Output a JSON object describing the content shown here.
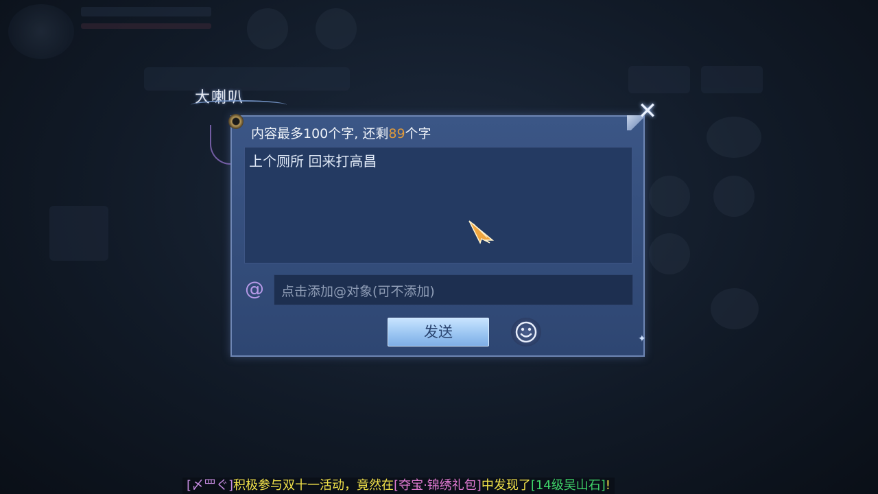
{
  "title": "大喇叭",
  "hint": {
    "prefix": "内容最多100个字, 还剩",
    "remaining": "89",
    "suffix": "个字"
  },
  "message_text": "上个厕所 回来打高昌",
  "mention_placeholder": "点击添加@对象(可不添加)",
  "send_label": "发送",
  "at_symbol": "@",
  "close_symbol": "✕",
  "announcement": {
    "name": "[〆罒ぐ]",
    "text1": "积极参与双十一活动，竟然在",
    "item1": "[夺宝·锦绣礼包]",
    "text2": "中发现了",
    "item2": "[14级吴山石]",
    "end": "!"
  },
  "colors": {
    "accent_orange": "#e09a3a",
    "name_purple": "#c58be0",
    "text_yellow": "#f2e24a",
    "item_pink": "#e07ad2",
    "item_green": "#3fd56a"
  },
  "icons": [
    "close-icon",
    "at-icon",
    "emoji-smiley-icon",
    "cursor-arrow-icon"
  ]
}
